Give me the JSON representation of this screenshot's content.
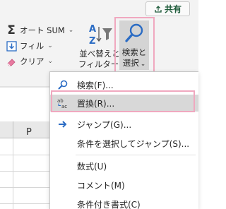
{
  "ribbon": {
    "share_label": "共有",
    "autosum_label": "オート SUM",
    "fill_label": "フィル",
    "clear_label": "クリア",
    "sort_filter_label_line1": "並べ替えと",
    "sort_filter_label_line2": "フィルター",
    "find_select_label_line1": "検索と",
    "find_select_label_line2": "選択"
  },
  "sheet": {
    "column_header": "P"
  },
  "menu": {
    "items": [
      {
        "label": "検索(F)...",
        "icon": "search-icon"
      },
      {
        "label": "置換(R)...",
        "icon": "replace-icon",
        "selected": true
      },
      {
        "label": "ジャンプ(G)...",
        "icon": "arrow-right-icon"
      },
      {
        "label": "条件を選択してジャンプ(S)...",
        "icon": ""
      },
      {
        "label": "数式(U)",
        "icon": ""
      },
      {
        "label": "コメント(M)",
        "icon": ""
      },
      {
        "label": "条件付き書式(C)",
        "icon": ""
      }
    ]
  },
  "colors": {
    "highlight": "#f0a8bf",
    "accent_blue": "#2b6cc4",
    "share_green": "#1f5c3b"
  }
}
